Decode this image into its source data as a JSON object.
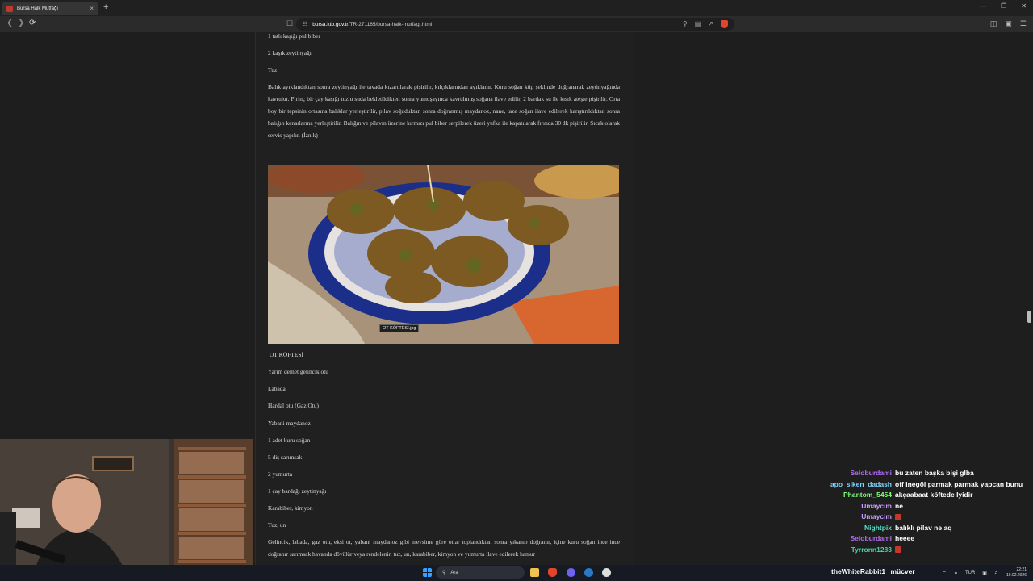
{
  "browser": {
    "tab_title": "Bursa Halk Mutfağı",
    "tab_close": "×",
    "new_tab": "+",
    "url_domain": "bursa.ktb.gov.tr",
    "url_path": "/TR-271165/bursa-halk-mutfagi.html"
  },
  "article": {
    "lines_top": [
      "1 tatlı kaşığı pul biber",
      "2 kaşık zeytinyağı",
      "Tuz"
    ],
    "paragraph_1": "Balık ayıklandıktan sonra zeytinyağı ile tavada kızartılarak pişirilir, kılçıklarından ayıklanır. Kuru soğan küp şeklinde doğranarak zeytinyağında kavrulur. Pirinç bir çay kaşığı tuzlu suda bekletildikten sonra yumuşayınca kavrulmuş soğana ilave edilir, 2 bardak su ile kısık ateşte pişirilir. Orta boy bir tepsinin ortasına balıklar yerleştirilir, pilav soğuduktan sonra doğranmış maydanoz, nane, taze soğan ilave edilerek karıştırıldıktan sonra balığın kenarlarına yerleştirilir. Balığın ve pilavın üzerine kırmızı pul biber serpilerek  üzeri yufka ile kapatılarak fırında 30 dk pişirilir. Sıcak olarak servis yapılır. (İznik)",
    "image_tooltip": "OT KÖFTESİ.jpg",
    "heading": "OT KÖFTESİ",
    "ingredients": [
      "Yarım demet gelincik otu",
      "Labada",
      "Hardal otu (Gaz Otu)",
      "Yabani maydanoz",
      "1 adet kuru soğan",
      "5 diş sarımsak",
      "2 yumurta",
      "1 çay bardağı zeytinyağı",
      "Karabiber, kimyon",
      "Tuz, un"
    ],
    "paragraph_2": "Gelincik, labada, gaz otu, ekşi ot, yabani maydanoz gibi mevsime göre   otlar toplandıktan sonra yıkanıp doğranır, içine kuru soğan ince ince doğranır sarımsak havanda dövülür veya rendelenir, tuz, un, karabiber, kimyon ve yumurta ilave edilerek hamur"
  },
  "chat": [
    {
      "user": "Seloburdami",
      "color": "#b26cf2",
      "text": "bu zaten başka bişi glba"
    },
    {
      "user": "apo_siken_dadash",
      "color": "#7fd4ff",
      "text": "off inegöl parmak parmak yapcan bunu"
    },
    {
      "user": "Phantom_5454",
      "color": "#7dff7a",
      "text": "akçaabaat köftede lyidir"
    },
    {
      "user": "Umaycim",
      "color": "#c59cff",
      "text": "ne"
    },
    {
      "user": "Umaycim",
      "color": "#c59cff",
      "text": ""
    },
    {
      "user": "Nightpix",
      "color": "#4de3c5",
      "text": "balıklı pilav ne aq"
    },
    {
      "user": "Seloburdami",
      "color": "#b26cf2",
      "text": "heeee"
    },
    {
      "user": "Tyrronn1283",
      "color": "#4fd1a5",
      "text": ""
    }
  ],
  "overlay": {
    "user": "theWhiteRabbit1",
    "text": "mücver"
  },
  "taskbar": {
    "search_placeholder": "Ara",
    "lang": "TUR",
    "time": "22:21",
    "date": "19.02.2026"
  }
}
